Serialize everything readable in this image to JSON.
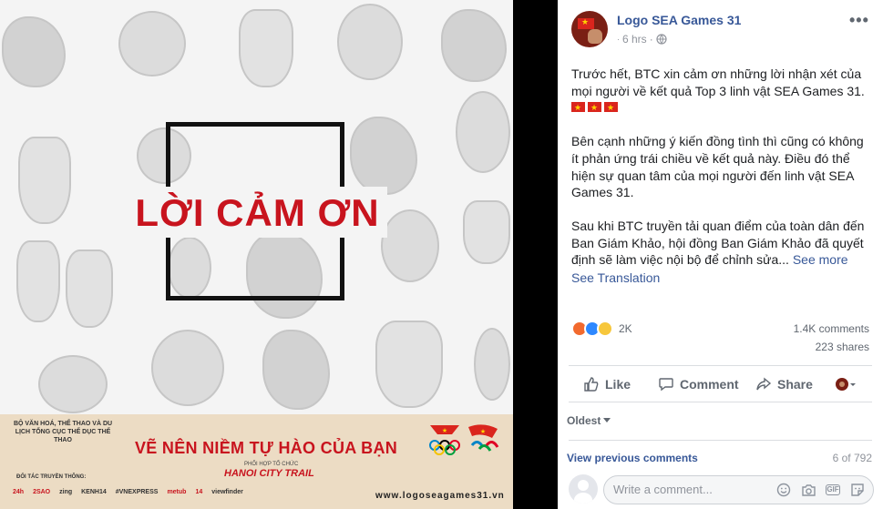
{
  "image": {
    "headline": "LỜI CẢM ƠN",
    "banner": {
      "ministry": "BỘ VĂN HOÁ, THỂ THAO VÀ DU LỊCH TỔNG CỤC THỂ DỤC THỂ THAO",
      "slogan": "VẼ NÊN NIỀM TỰ HÀO CỦA BẠN",
      "co_org": "PHỐI HỢP TỔ CHỨC",
      "co_org_name": "HANOI CITY TRAIL",
      "media_label": "ĐỐI TÁC TRUYỀN THÔNG:",
      "partners": [
        "24h",
        "2SAO",
        "zing",
        "KENH14",
        "#VNEXPRESS",
        "metub",
        "14",
        "viewfinder"
      ],
      "url": "www.logoseagames31.vn"
    }
  },
  "post": {
    "page_name": "Logo SEA Games 31",
    "time": "6 hrs",
    "more": "•••",
    "paragraphs": [
      "Trước hết, BTC xin cảm ơn những lời nhận xét của mọi người về kết quả Top 3 linh vật SEA Games 31.",
      "Bên cạnh những ý kiến đồng tình thì cũng có không ít phản ứng trái chiều về kết quả này. Điều đó thể hiện sự quan tâm của mọi người đến linh vật SEA Games 31.",
      "Sau khi BTC truyền tải quan điểm của toàn dân đến Ban Giám Khảo, hội đồng Ban Giám Khảo đã quyết định sẽ làm việc nội bộ để chỉnh sửa..."
    ],
    "see_more": "See more",
    "see_translation": "See Translation",
    "reaction_count": "2K",
    "comments_count": "1.4K comments",
    "shares_count": "223 shares",
    "actions": {
      "like": "Like",
      "comment": "Comment",
      "share": "Share"
    },
    "sort": "Oldest",
    "view_previous": "View previous comments",
    "page_count": "6 of 792",
    "comment_placeholder": "Write a comment...",
    "colors": {
      "link": "#385898",
      "headline": "#c8141e"
    }
  }
}
